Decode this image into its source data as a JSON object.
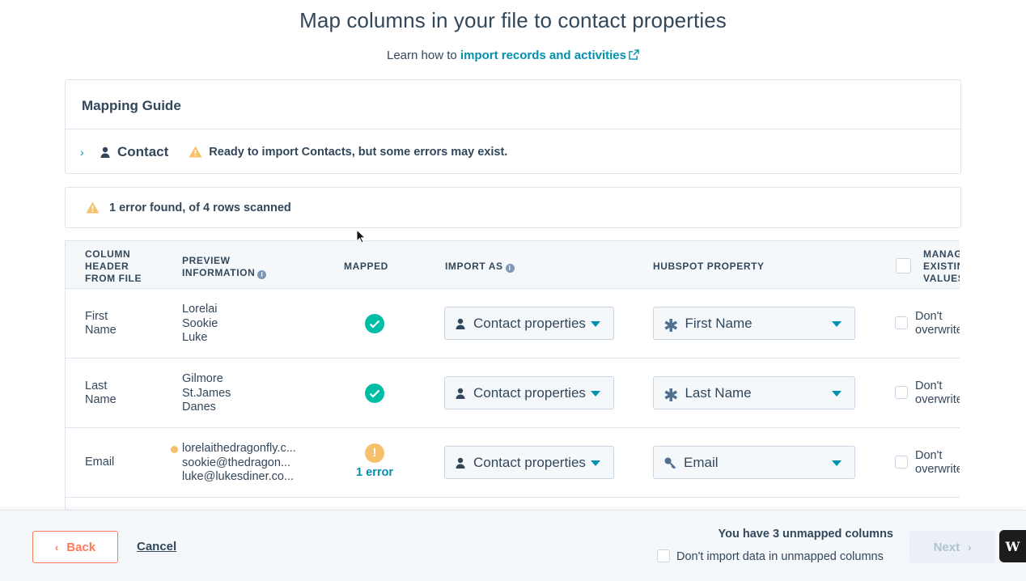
{
  "header": {
    "title": "Map columns in your file to contact properties",
    "learn_prefix": "Learn how to",
    "learn_link": "import records and activities"
  },
  "guide": {
    "title": "Mapping Guide",
    "object_label": "Contact",
    "status_message": "Ready to import Contacts, but some errors may exist."
  },
  "error_summary": {
    "text": "1 error found, of 4 rows scanned"
  },
  "table": {
    "headers": {
      "column_header": [
        "COLUMN",
        "HEADER",
        "FROM FILE"
      ],
      "preview": [
        "PREVIEW",
        "INFORMATION"
      ],
      "mapped": "MAPPED",
      "import_as": "IMPORT AS",
      "hubspot_property": "HUBSPOT PROPERTY",
      "manage": [
        "MANAGE",
        "EXISTING",
        "VALUES"
      ]
    },
    "rows": [
      {
        "column_name": [
          "First",
          "Name"
        ],
        "preview": [
          "Lorelai",
          "Sookie",
          "Luke"
        ],
        "mapped_status": "ok",
        "import_as": "Contact properties",
        "property": "First Name",
        "property_icon": "asterisk-icon",
        "overwrite_label": "Don't overwrite"
      },
      {
        "column_name": [
          "Last",
          "Name"
        ],
        "preview": [
          "Gilmore",
          "St.James",
          "Danes"
        ],
        "mapped_status": "ok",
        "import_as": "Contact properties",
        "property": "Last Name",
        "property_icon": "asterisk-icon",
        "overwrite_label": "Don't overwrite"
      },
      {
        "column_name": [
          "Email"
        ],
        "preview": [
          "lorelaithedragonfly.c...",
          "sookie@thedragon...",
          "luke@lukesdiner.co..."
        ],
        "mapped_status": "error",
        "error_label": "1 error",
        "import_as": "Contact properties",
        "property": "Email",
        "property_icon": "key-icon",
        "overwrite_label": "Don't overwrite"
      }
    ]
  },
  "footer": {
    "back_label": "Back",
    "cancel_label": "Cancel",
    "unmapped_message": "You have 3 unmapped columns",
    "unmapped_checkbox_label": "Don't import data in unmapped columns",
    "next_label": "Next",
    "badge_label": "W"
  },
  "colors": {
    "link": "#0091ae",
    "text": "#33475b",
    "success": "#00bda5",
    "warning": "#f5c26b",
    "accent": "#ff7a59",
    "border": "#dfe3eb"
  }
}
